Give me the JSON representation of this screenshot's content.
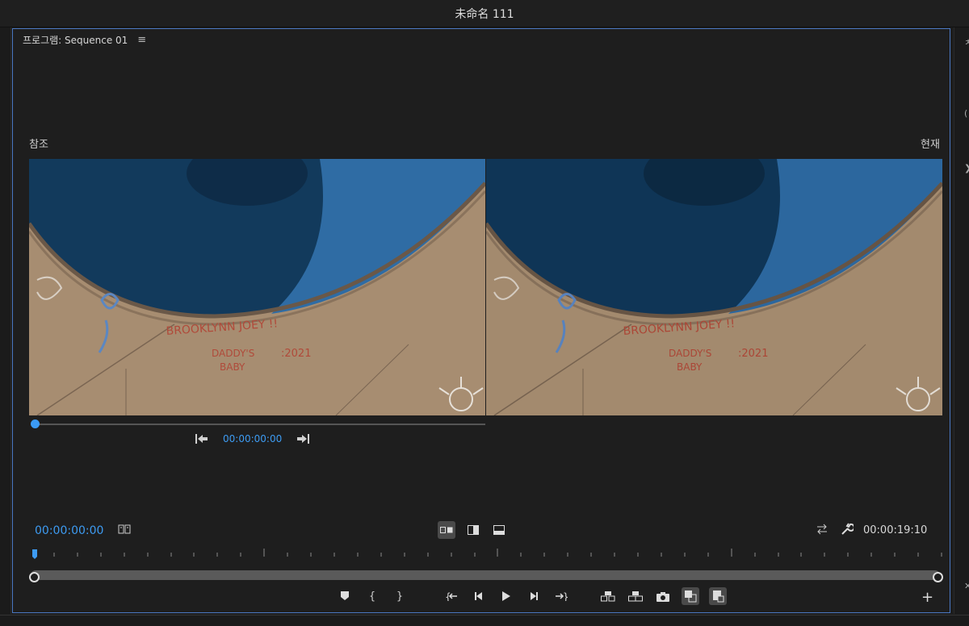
{
  "window": {
    "title": "未命名 111"
  },
  "panel": {
    "title": "프로그램: Sequence 01",
    "menu_icon": "hamburger-menu-icon"
  },
  "compare": {
    "left_label": "참조",
    "right_label": "현재",
    "reference_time": "00:00:00:00"
  },
  "playhead": {
    "timecode": "00:00:00:00",
    "duration": "00:00:19:10"
  },
  "icons": {
    "accent": "#3d9bf2",
    "view_modes": [
      "side-by-side-icon",
      "vertical-split-icon",
      "horizontal-split-icon"
    ],
    "transport": [
      "add-marker-icon",
      "mark-in-icon",
      "mark-out-icon",
      "go-to-in-icon",
      "step-back-icon",
      "play-icon",
      "step-forward-icon",
      "go-to-out-icon",
      "insert-icon",
      "overwrite-icon",
      "export-frame-icon",
      "comparison-view-icon",
      "proxy-toggle-icon"
    ]
  }
}
